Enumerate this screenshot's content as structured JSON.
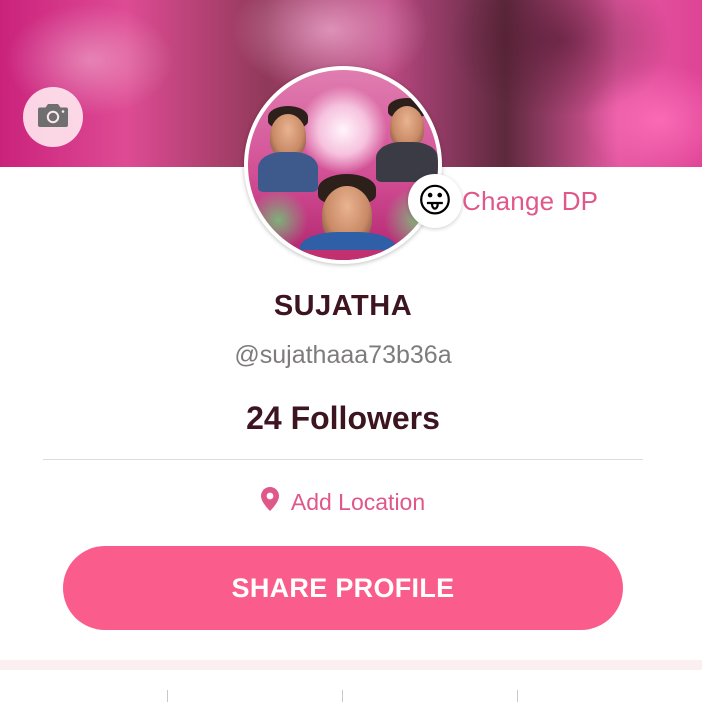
{
  "cover": {
    "camera_icon": "camera-icon"
  },
  "profile": {
    "change_dp_label": "Change DP",
    "change_dp_emoji": "😛",
    "name": "SUJATHA",
    "handle": "@sujathaaa73b36a",
    "followers": "24 Followers",
    "location_label": "Add Location",
    "location_icon": "location-pin-icon"
  },
  "actions": {
    "share_label": "SHARE PROFILE"
  },
  "colors": {
    "accent": "#fa5d8b",
    "accent_text": "#e0578a",
    "name_text": "#3d1521",
    "handle_text": "#7e7b7d"
  }
}
